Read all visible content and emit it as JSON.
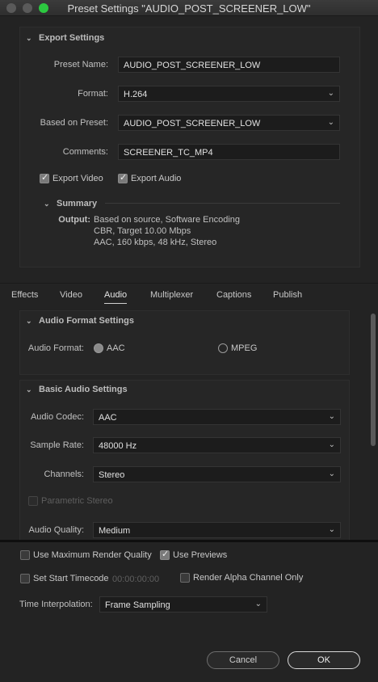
{
  "window": {
    "title": "Preset Settings \"AUDIO_POST_SCREENER_LOW\""
  },
  "export_settings": {
    "header": "Export Settings",
    "preset_name_label": "Preset Name:",
    "preset_name_value": "AUDIO_POST_SCREENER_LOW",
    "format_label": "Format:",
    "format_value": "H.264",
    "based_on_label": "Based on Preset:",
    "based_on_value": "AUDIO_POST_SCREENER_LOW",
    "comments_label": "Comments:",
    "comments_value": "SCREENER_TC_MP4",
    "export_video_label": "Export Video",
    "export_video_checked": true,
    "export_audio_label": "Export Audio",
    "export_audio_checked": true
  },
  "summary": {
    "header": "Summary",
    "output_label": "Output:",
    "line1": "Based on source, Software Encoding",
    "line2": "CBR, Target 10.00 Mbps",
    "line3": "AAC, 160 kbps, 48 kHz, Stereo"
  },
  "tabs": [
    {
      "label": "Effects"
    },
    {
      "label": "Video"
    },
    {
      "label": "Audio",
      "active": true
    },
    {
      "label": "Multiplexer"
    },
    {
      "label": "Captions"
    },
    {
      "label": "Publish"
    }
  ],
  "audio_format": {
    "header": "Audio Format Settings",
    "label": "Audio Format:",
    "options": [
      "AAC",
      "MPEG"
    ],
    "selected": "AAC"
  },
  "basic_audio": {
    "header": "Basic Audio Settings",
    "codec_label": "Audio Codec:",
    "codec_value": "AAC",
    "sample_rate_label": "Sample Rate:",
    "sample_rate_value": "48000 Hz",
    "channels_label": "Channels:",
    "channels_value": "Stereo",
    "parametric_label": "Parametric Stereo",
    "quality_label": "Audio Quality:",
    "quality_value": "Medium"
  },
  "footer": {
    "max_render_label": "Use Maximum Render Quality",
    "max_render_checked": false,
    "use_previews_label": "Use Previews",
    "use_previews_checked": true,
    "start_timecode_label": "Set Start Timecode",
    "start_timecode_checked": false,
    "timecode_value": "00:00:00:00",
    "alpha_label": "Render Alpha Channel Only",
    "alpha_checked": false,
    "interp_label": "Time Interpolation:",
    "interp_value": "Frame Sampling",
    "cancel_label": "Cancel",
    "ok_label": "OK"
  },
  "colors": {
    "background": "#232323",
    "window_title_zoom": "#2cc840"
  }
}
